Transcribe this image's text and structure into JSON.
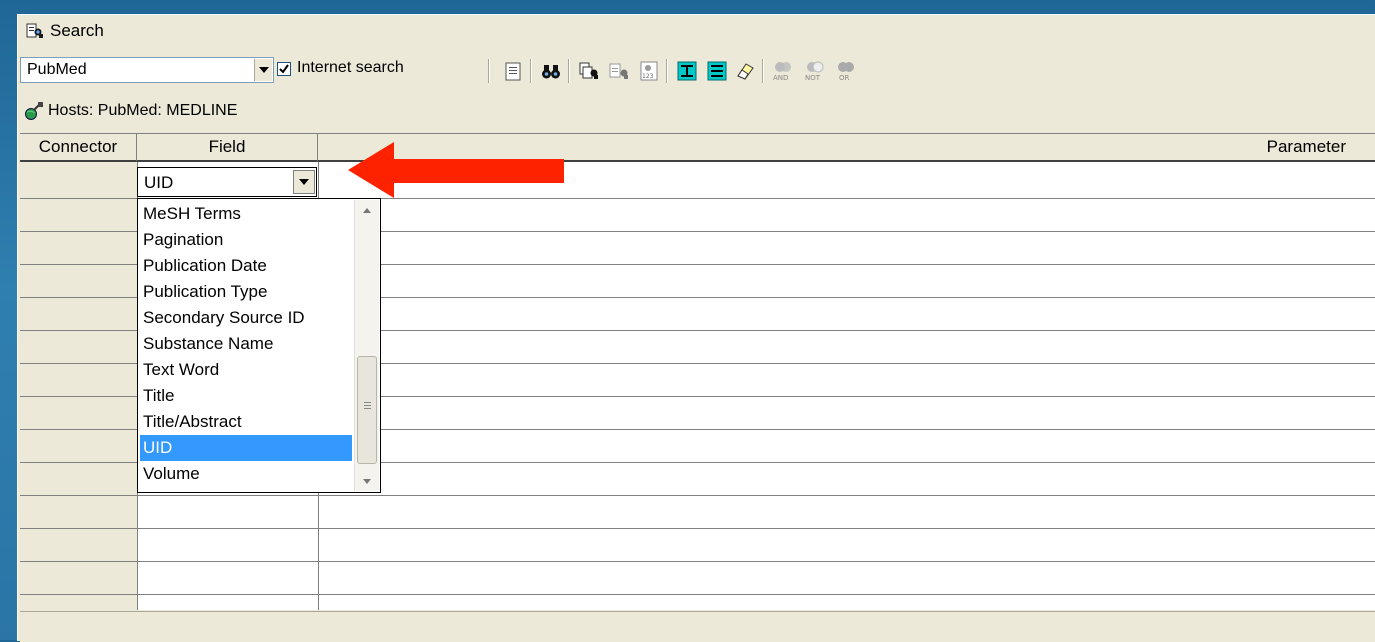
{
  "window": {
    "title": "Search"
  },
  "toolbar": {
    "database_value": "PubMed",
    "internet_search_label": "Internet search",
    "internet_search_checked": true,
    "buttons": [
      "clipboard-icon",
      "binoculars-icon",
      "copy-search-icon",
      "search-records-icon",
      "numbered-search-icon",
      "insert-row-icon",
      "delete-row-icon",
      "eraser-icon",
      "and-icon",
      "not-icon",
      "or-icon"
    ],
    "and_label": "AND",
    "not_label": "NOT",
    "or_label": "OR"
  },
  "hosts": {
    "label": "Hosts: PubMed: MEDLINE"
  },
  "grid": {
    "headers": {
      "connector": "Connector",
      "field": "Field",
      "parameter": "Parameter"
    },
    "active_field_value": "UID",
    "field_options": [
      "MeSH Terms",
      "Pagination",
      "Publication Date",
      "Publication Type",
      "Secondary Source ID",
      "Substance Name",
      "Text Word",
      "Title",
      "Title/Abstract",
      "UID",
      "Volume"
    ],
    "selected_option": "UID"
  },
  "colors": {
    "background": "#2a75a6",
    "window": "#ece9d8",
    "selection": "#3399ff",
    "arrow": "#ff2200"
  }
}
